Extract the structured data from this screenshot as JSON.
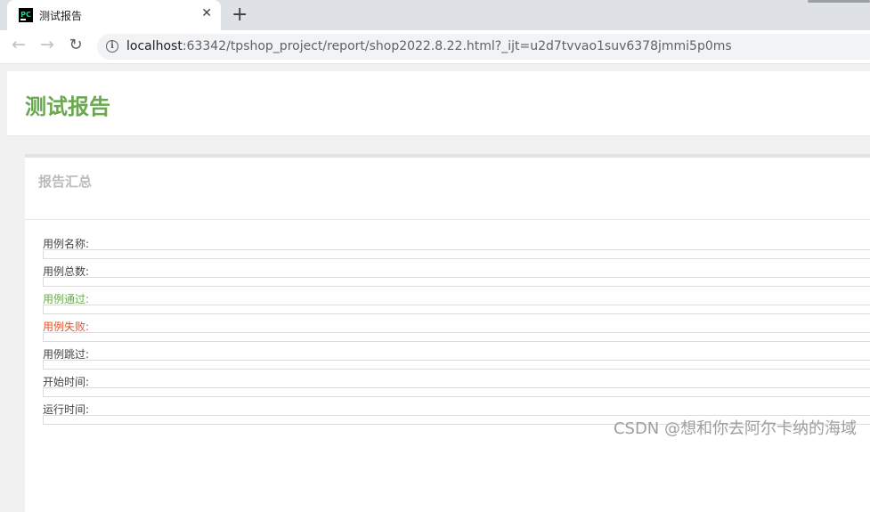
{
  "browser": {
    "tab": {
      "favicon_text": "PC",
      "title": "测试报告",
      "close_glyph": "✕"
    },
    "new_tab_glyph": "+",
    "nav": {
      "back_glyph": "←",
      "forward_glyph": "→",
      "reload_glyph": "↻"
    },
    "address": {
      "info_glyph": "i",
      "host": "localhost",
      "rest": ":63342/tpshop_project/report/shop2022.8.22.html?_ijt=u2d7tvvao1suv6378jmmi5p0ms"
    }
  },
  "report": {
    "title": "测试报告",
    "summary": {
      "heading": "报告汇总",
      "fields": [
        {
          "label": "用例名称:",
          "status": "normal",
          "value": ""
        },
        {
          "label": "用例总数:",
          "status": "normal",
          "value": ""
        },
        {
          "label": "用例通过:",
          "status": "pass",
          "value": ""
        },
        {
          "label": "用例失败:",
          "status": "fail",
          "value": ""
        },
        {
          "label": "用例跳过:",
          "status": "normal",
          "value": ""
        },
        {
          "label": "开始时间:",
          "status": "normal",
          "value": ""
        },
        {
          "label": "运行时间:",
          "status": "normal",
          "value": ""
        }
      ]
    }
  },
  "watermark": "CSDN @想和你去阿尔卡纳的海域",
  "colors": {
    "title_green": "#6aa84f",
    "pass_green": "#6aa84f",
    "fail_orange": "#e2542a",
    "heading_gray": "#bbbbbb"
  }
}
